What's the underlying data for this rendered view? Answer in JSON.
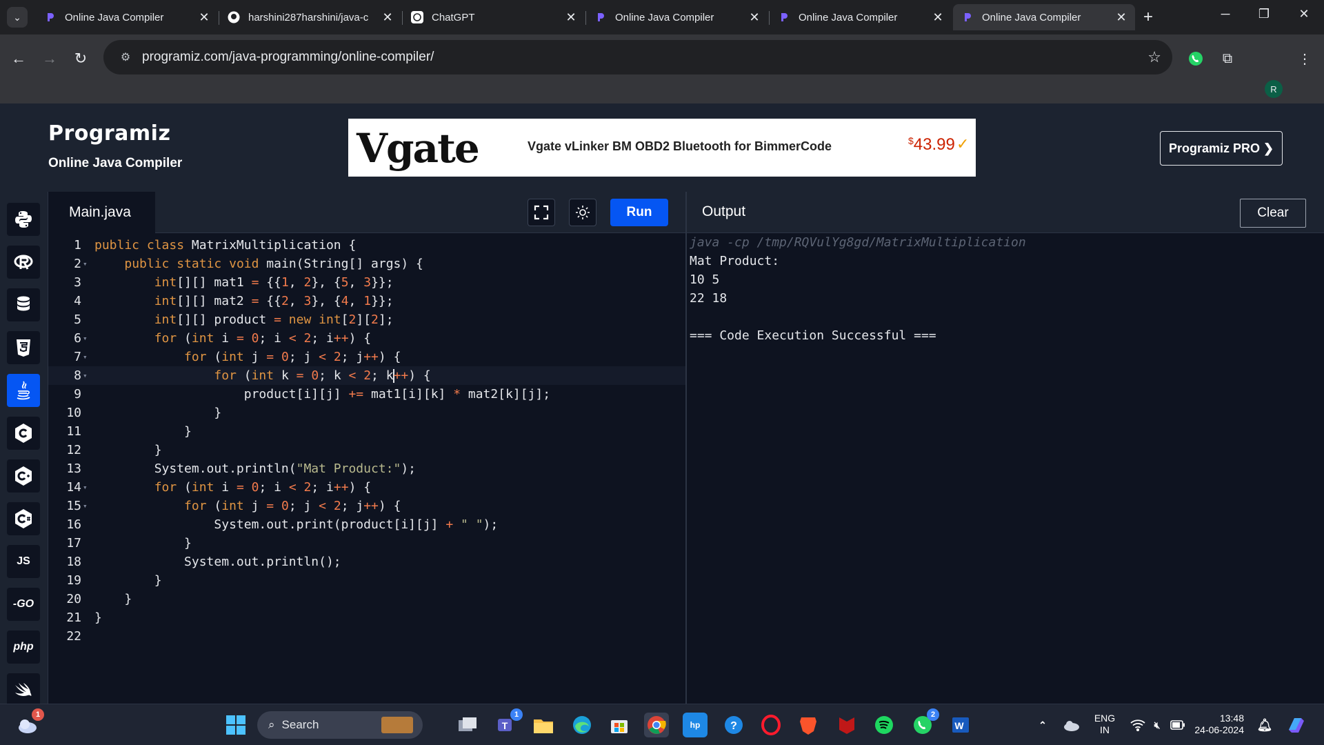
{
  "browser": {
    "tabs": [
      {
        "title": "Online Java Compiler",
        "icon": "programiz-favicon"
      },
      {
        "title": "harshini287harshini/java-c",
        "icon": "github-favicon"
      },
      {
        "title": "ChatGPT",
        "icon": "chatgpt-favicon"
      },
      {
        "title": "Online Java Compiler",
        "icon": "programiz-favicon"
      },
      {
        "title": "Online Java Compiler",
        "icon": "programiz-favicon"
      },
      {
        "title": "Online Java Compiler",
        "icon": "programiz-favicon"
      }
    ],
    "active_tab_index": 5,
    "url": "programiz.com/java-programming/online-compiler/",
    "profile_initial": "R"
  },
  "site": {
    "logo": "Programiz",
    "subtitle": "Online Java Compiler",
    "pro_button": "Programiz PRO ❯"
  },
  "ad": {
    "brand": "Vgate",
    "product": "Vgate vLinker BM OBD2 Bluetooth for BimmerCode",
    "price_symbol": "$",
    "price": "43.99"
  },
  "sidebar": {
    "languages": [
      {
        "name": "python",
        "label": "",
        "active": false
      },
      {
        "name": "r",
        "label": "",
        "active": false
      },
      {
        "name": "sql",
        "label": "",
        "active": false
      },
      {
        "name": "html",
        "label": "",
        "active": false
      },
      {
        "name": "java",
        "label": "",
        "active": true
      },
      {
        "name": "c",
        "label": "",
        "active": false
      },
      {
        "name": "cpp",
        "label": "",
        "active": false
      },
      {
        "name": "csharp",
        "label": "",
        "active": false
      },
      {
        "name": "javascript",
        "label": "JS",
        "active": false
      },
      {
        "name": "go",
        "label": "-GO",
        "active": false
      },
      {
        "name": "php",
        "label": "php",
        "active": false
      },
      {
        "name": "swift",
        "label": "",
        "active": false
      }
    ]
  },
  "editor": {
    "file_tab": "Main.java",
    "run_label": "Run",
    "current_line": 8,
    "lines": [
      "public class MatrixMultiplication {",
      "    public static void main(String[] args) {",
      "        int[][] mat1 = {{1, 2}, {5, 3}};",
      "        int[][] mat2 = {{2, 3}, {4, 1}};",
      "        int[][] product = new int[2][2];",
      "        for (int i = 0; i < 2; i++) {",
      "            for (int j = 0; j < 2; j++) {",
      "                for (int k = 0; k < 2; k++) {",
      "                    product[i][j] += mat1[i][k] * mat2[k][j];",
      "                }",
      "            }",
      "        }",
      "        System.out.println(\"Mat Product:\");",
      "        for (int i = 0; i < 2; i++) {",
      "            for (int j = 0; j < 2; j++) {",
      "                System.out.print(product[i][j] + \" \");",
      "            }",
      "            System.out.println();",
      "        }",
      "    }",
      "}",
      ""
    ],
    "foldable_lines": [
      2,
      6,
      7,
      8,
      14,
      15
    ]
  },
  "output": {
    "title": "Output",
    "clear_label": "Clear",
    "command": "java -cp /tmp/RQVulYg8gd/MatrixMultiplication",
    "lines": [
      "Mat Product:",
      "10 5",
      "22 18",
      "",
      "=== Code Execution Successful ==="
    ]
  },
  "taskbar": {
    "search_placeholder": "Search",
    "weather_badge": "1",
    "teams_badge": "1",
    "whatsapp_badge": "2",
    "language": "ENG",
    "region": "IN",
    "time": "13:48",
    "date": "24-06-2024"
  }
}
